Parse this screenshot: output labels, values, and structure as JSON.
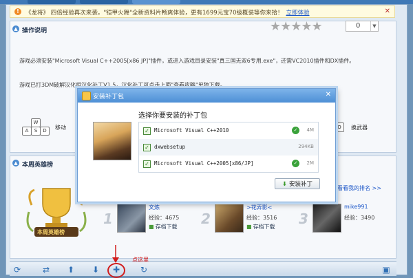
{
  "notice": {
    "text": "《龙将》 四倍经验再次来袭，\"铠甲火舞\"全新资料片畅爽体验，更有1699元宝70级概装等你来拾！",
    "link": "立即体验"
  },
  "guide": {
    "title": "操作说明",
    "rating_value": "0",
    "line1": "游戏必须安装\"Microsoft Visual C++2005[x86 JP]\"插件，或进入游戏目录安装\"真三国无双6专用.exe\"，还需VC2010插件和DX插件。",
    "line2": "游戏已打3DM破解汉化组汉化补丁V1.5，汉化补丁可点击上面\"查看攻略\"单独下载。",
    "keys": [
      "W",
      "A",
      "S",
      "D"
    ],
    "move_label": "移动",
    "gun_key": "O",
    "gun_label": "换武器"
  },
  "heroes": {
    "title": "本周英雄榜",
    "more": "看看我的排名 >>",
    "trophy_label": "本周英雄榜",
    "list": [
      {
        "rank": "1",
        "name": "文炼",
        "exp": "经验：4675",
        "download": "存档下载"
      },
      {
        "rank": "2",
        "name": ">花弄影<",
        "exp": "经验：3516",
        "download": "存档下载"
      },
      {
        "rank": "3",
        "name": "mike991",
        "exp": "经验：3490",
        "download": "存档下载"
      }
    ]
  },
  "toolbar": {
    "annotation": "点这里",
    "buttons": [
      "refresh-icon",
      "share-icon",
      "up-icon",
      "down-icon",
      "add-icon",
      "redo-icon",
      "gamepad-icon"
    ]
  },
  "dialog": {
    "title": "安装补丁包",
    "heading": "选择你要安装的补丁包",
    "items": [
      {
        "name": "Microsoft Visual C++2010",
        "size": "4M",
        "done": true
      },
      {
        "name": "dxwebsetup",
        "size": "294KB",
        "done": false
      },
      {
        "name": "Microsoft Visual C++2005[x86/JP]",
        "size": "2M",
        "done": true
      }
    ],
    "install_label": "安装补丁"
  },
  "colors": {
    "accent": "#4d8fd6",
    "highlight": "#d21c1c",
    "ok": "#3aa23a"
  }
}
